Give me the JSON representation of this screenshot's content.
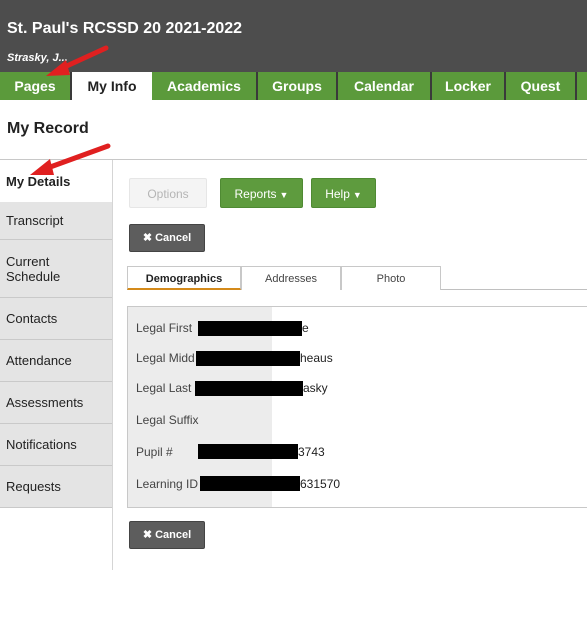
{
  "header": {
    "school_name": "St. Paul's RCSSD 20 2021-2022",
    "user_name": "Strasky, J..."
  },
  "nav": {
    "tabs": [
      {
        "label": "Pages",
        "active": false
      },
      {
        "label": "My Info",
        "active": true
      },
      {
        "label": "Academics",
        "active": false
      },
      {
        "label": "Groups",
        "active": false
      },
      {
        "label": "Calendar",
        "active": false
      },
      {
        "label": "Locker",
        "active": false
      },
      {
        "label": "Quest",
        "active": false
      }
    ]
  },
  "page_title": "My Record",
  "side_menu": {
    "items": [
      {
        "label": "My Details",
        "active": true
      },
      {
        "label": "Transcript",
        "active": false
      },
      {
        "label": "Current Schedule",
        "active": false
      },
      {
        "label": "Contacts",
        "active": false
      },
      {
        "label": "Attendance",
        "active": false
      },
      {
        "label": "Assessments",
        "active": false
      },
      {
        "label": "Notifications",
        "active": false
      },
      {
        "label": "Requests",
        "active": false
      }
    ]
  },
  "toolbar": {
    "options_label": "Options",
    "reports_label": "Reports",
    "help_label": "Help",
    "cancel_label": "Cancel"
  },
  "subtabs": [
    {
      "label": "Demographics",
      "active": true
    },
    {
      "label": "Addresses",
      "active": false
    },
    {
      "label": "Photo",
      "active": false
    }
  ],
  "fields": [
    {
      "label": "Legal First",
      "value_tail": "e"
    },
    {
      "label": "Legal Midd",
      "value_tail": "heaus"
    },
    {
      "label": "Legal Last",
      "value_tail": "asky"
    },
    {
      "label": "Legal Suffix",
      "value_tail": ""
    },
    {
      "label": "Pupil #",
      "value_tail": "3743"
    },
    {
      "label": "Learning ID",
      "value_tail": "631570"
    }
  ],
  "colors": {
    "header_bg": "#4d4d4d",
    "nav_green": "#5b9a3b",
    "arrow_red": "#e02020",
    "active_tab_underline": "#d48a1a"
  },
  "annotations": [
    "arrow pointing to Pages tab",
    "arrow pointing to My Details"
  ]
}
